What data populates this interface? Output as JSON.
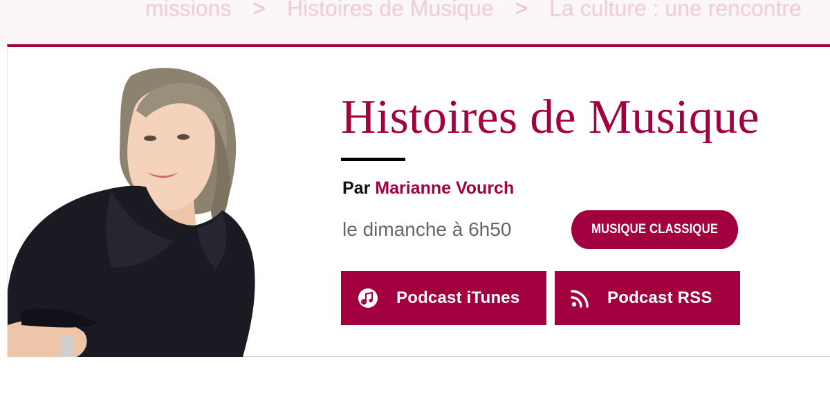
{
  "breadcrumb": {
    "items": [
      "missions",
      "Histoires de Musique",
      "La culture : une rencontre"
    ],
    "separator": ">"
  },
  "program": {
    "title": "Histoires de Musique",
    "author_prefix": "Par",
    "author_name": "Marianne Vourch",
    "schedule": "le dimanche à 6h50",
    "genre": "MUSIQUE CLASSIQUE"
  },
  "buttons": {
    "itunes_label": "Podcast iTunes",
    "itunes_icon": "music-note-icon",
    "rss_label": "Podcast RSS",
    "rss_icon": "rss-icon"
  },
  "colors": {
    "brand": "#a3003f",
    "text_dark": "#111111",
    "text_muted": "#666666"
  }
}
